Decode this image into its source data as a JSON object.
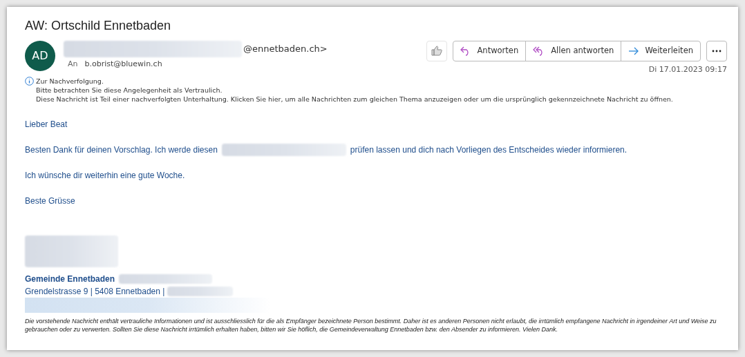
{
  "subject": "AW: Ortschild Ennetbaden",
  "sender": {
    "initials": "AD",
    "address_tail": "@ennetbaden.ch>"
  },
  "to_label": "An",
  "recipient": "b.obrist@bluewin.ch",
  "date": "Di 17.01.2023 09:17",
  "actions": [
    {
      "kind": "reply",
      "label": "Antworten"
    },
    {
      "kind": "reply_all",
      "label": "Allen antworten"
    },
    {
      "kind": "forward",
      "label": "Weiterleiten"
    }
  ],
  "info_lines": [
    "Zur Nachverfolgung.",
    "Bitte betrachten Sie diese Angelegenheit als Vertraulich.",
    "Diese Nachricht ist Teil einer nachverfolgten Unterhaltung. Klicken Sie hier, um alle Nachrichten zum gleichen Thema anzuzeigen oder um die ursprünglich gekennzeichnete Nachricht zu öffnen."
  ],
  "body": [
    {
      "segments": [
        {
          "kind": "text",
          "text": "Lieber Beat"
        }
      ]
    },
    {
      "segments": [
        {
          "kind": "text",
          "text": "Besten Dank für deinen Vorschlag. Ich werde diesen"
        },
        {
          "kind": "redacted"
        },
        {
          "kind": "text",
          "text": "prüfen lassen und dich nach Vorliegen des Entscheides wieder informieren."
        }
      ]
    },
    {
      "segments": [
        {
          "kind": "text",
          "text": "Ich wünsche dir weiterhin eine gute Woche."
        }
      ]
    },
    {
      "segments": [
        {
          "kind": "text",
          "text": "Beste Grüsse"
        }
      ]
    }
  ],
  "signature": {
    "organisation": "Gemeinde Ennetbaden",
    "address": "Grendelstrasse 9 | 5408 Ennetbaden |"
  },
  "disclaimer": "Die vorstehende Nachricht enthält vertrauliche Informationen und ist ausschliesslich für die als Empfänger bezeichnete Person bestimmt. Daher ist es anderen Personen nicht erlaubt, die irrtümlich empfangene Nachricht in irgendeiner Art und Weise zu gebrauchen oder zu verwerten. Sollten Sie diese Nachricht irrtümlich erhalten haben, bitten wir Sie höflich, die Gemeindeverwaltung Ennetbaden bzw. den Absender zu informieren. Vielen Dank."
}
